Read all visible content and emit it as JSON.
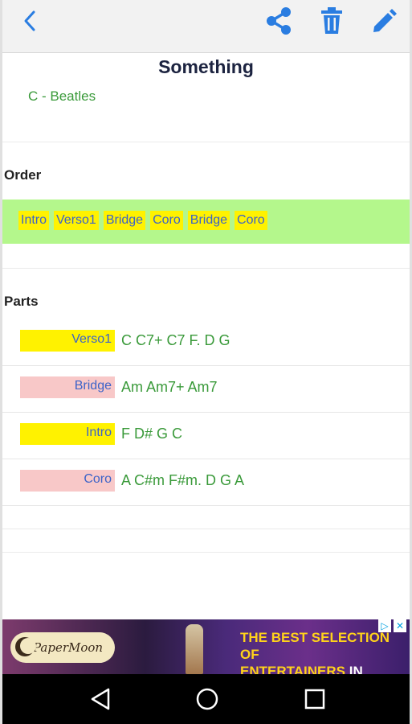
{
  "toolbar": {
    "icons": [
      "back-chevron-icon",
      "share-icon",
      "trash-icon",
      "edit-pencil-icon"
    ],
    "accent_color": "#2a7de1"
  },
  "song": {
    "title": "Something",
    "subtitle": "C - Beatles"
  },
  "order": {
    "heading": "Order",
    "items": [
      "Intro",
      "Verso1",
      "Bridge",
      "Coro",
      "Bridge",
      "Coro"
    ],
    "band_color": "#b4f78c",
    "chip_color": "#fff200"
  },
  "parts": {
    "heading": "Parts",
    "rows": [
      {
        "label": "Verso1",
        "chords": "C C7+ C7 F. D G",
        "color": "#fff200"
      },
      {
        "label": "Bridge",
        "chords": "Am Am7+ Am7",
        "color": "#f8c8c8"
      },
      {
        "label": "Intro",
        "chords": "F D# G C",
        "color": "#fff200"
      },
      {
        "label": "Coro",
        "chords": "A C#m F#m. D G A",
        "color": "#f8c8c8"
      }
    ]
  },
  "ad": {
    "brand": "PaperMoon",
    "line1": "THE BEST SELECTION OF",
    "line2a": "ENTERTAINERS",
    "line2b": "IN VIRGINIA"
  },
  "navbar": {
    "icons": [
      "back-triangle-icon",
      "home-circle-icon",
      "recents-square-icon"
    ]
  }
}
